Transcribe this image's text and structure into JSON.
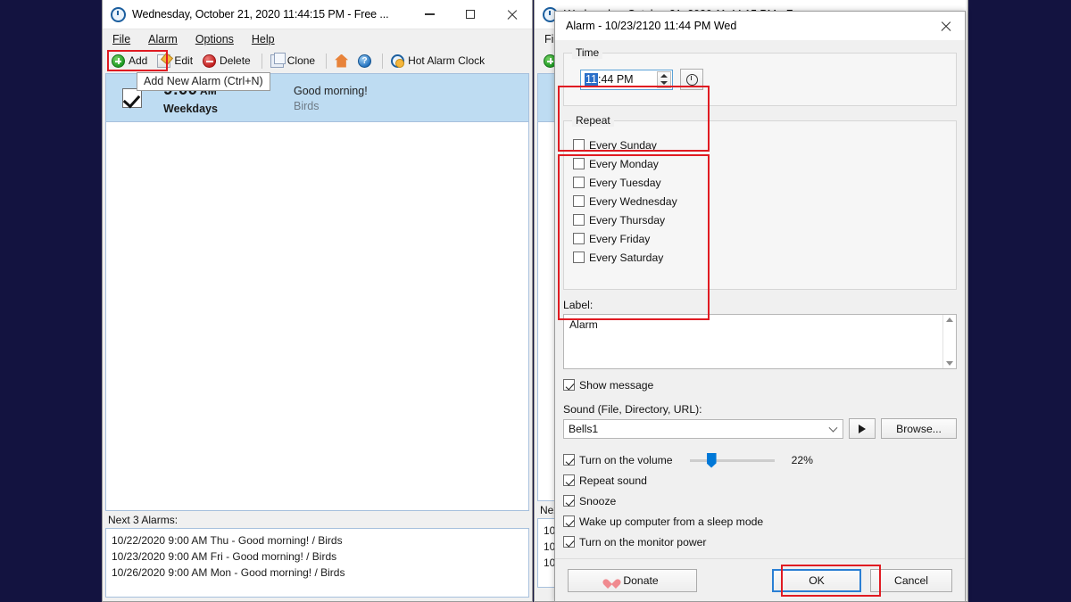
{
  "app": {
    "main_window": {
      "title": "Wednesday, October 21, 2020 11:44:15 PM - Free ...",
      "title_icon": "clock-icon",
      "window_buttons": {
        "minimize": "minimize-icon",
        "maximize": "maximize-icon",
        "close": "close-icon"
      },
      "menu": [
        {
          "label": "File",
          "mnemonic": "F"
        },
        {
          "label": "Alarm",
          "mnemonic": "A"
        },
        {
          "label": "Options",
          "mnemonic": "O"
        },
        {
          "label": "Help",
          "mnemonic": "H"
        }
      ],
      "toolbar": [
        {
          "label": "Add",
          "icon": "add-circle-icon",
          "highlighted": true
        },
        {
          "label": "Edit",
          "icon": "pencil-edit-icon"
        },
        {
          "label": "Delete",
          "icon": "delete-circle-icon"
        },
        {
          "label": "Clone",
          "icon": "copy-icon"
        },
        {
          "label": "",
          "icon": "home-icon"
        },
        {
          "label": "",
          "icon": "help-question-icon"
        },
        {
          "label": "Hot Alarm Clock",
          "icon": "hot-alarm-clock-icon"
        }
      ],
      "tooltip": "Add New Alarm (Ctrl+N)",
      "alarm_rows": [
        {
          "enabled": true,
          "time": "9:00",
          "ampm": "AM",
          "days": "Weekdays",
          "message": "Good morning!",
          "sound": "Birds"
        }
      ],
      "next_alarms_label": "Next 3 Alarms:",
      "next_alarms": [
        "10/22/2020 9:00 AM Thu - Good morning! / Birds",
        "10/23/2020 9:00 AM Fri - Good morning! / Birds",
        "10/26/2020 9:00 AM Mon - Good morning! / Birds"
      ]
    },
    "alarm_dialog": {
      "title": "Alarm - 10/23/2120 11:44 PM Wed",
      "close_icon": "close-icon",
      "time_group": {
        "legend": "Time",
        "value_selected": "11",
        "value_rest": ":44 PM",
        "spinner_icon": "up-down-spinner-icon",
        "clock_button_icon": "clock-picker-icon",
        "highlighted": true
      },
      "repeat_group": {
        "legend": "Repeat",
        "highlighted": true,
        "items": [
          {
            "label": "Every Sunday",
            "checked": false
          },
          {
            "label": "Every Monday",
            "checked": false
          },
          {
            "label": "Every Tuesday",
            "checked": false
          },
          {
            "label": "Every Wednesday",
            "checked": false
          },
          {
            "label": "Every Thursday",
            "checked": false
          },
          {
            "label": "Every Friday",
            "checked": false
          },
          {
            "label": "Every Saturday",
            "checked": false
          }
        ]
      },
      "label_field": {
        "caption": "Label:",
        "value": "Alarm"
      },
      "show_message": {
        "label": "Show message",
        "checked": true
      },
      "sound_field": {
        "caption": "Sound (File, Directory, URL):",
        "value": "Bells1",
        "play_icon": "play-icon",
        "browse_label": "Browse..."
      },
      "options": [
        {
          "label": "Turn on the volume",
          "checked": true,
          "volume_percent": "22%",
          "volume_value": 22
        },
        {
          "label": "Repeat sound",
          "checked": true
        },
        {
          "label": "Snooze",
          "checked": true
        },
        {
          "label": "Wake up computer from a sleep mode",
          "checked": true
        },
        {
          "label": "Turn on the monitor power",
          "checked": true
        }
      ],
      "buttons": {
        "donate": "Donate",
        "donate_icon": "heart-icon",
        "ok": "OK",
        "cancel": "Cancel",
        "ok_highlighted": true
      }
    }
  },
  "colors": {
    "desktop_background": "#131340",
    "highlight_red": "#e01b22",
    "selection_blue": "#2a6fc9",
    "row_selected": "#bedcf2",
    "accent_blue": "#0078d7"
  }
}
